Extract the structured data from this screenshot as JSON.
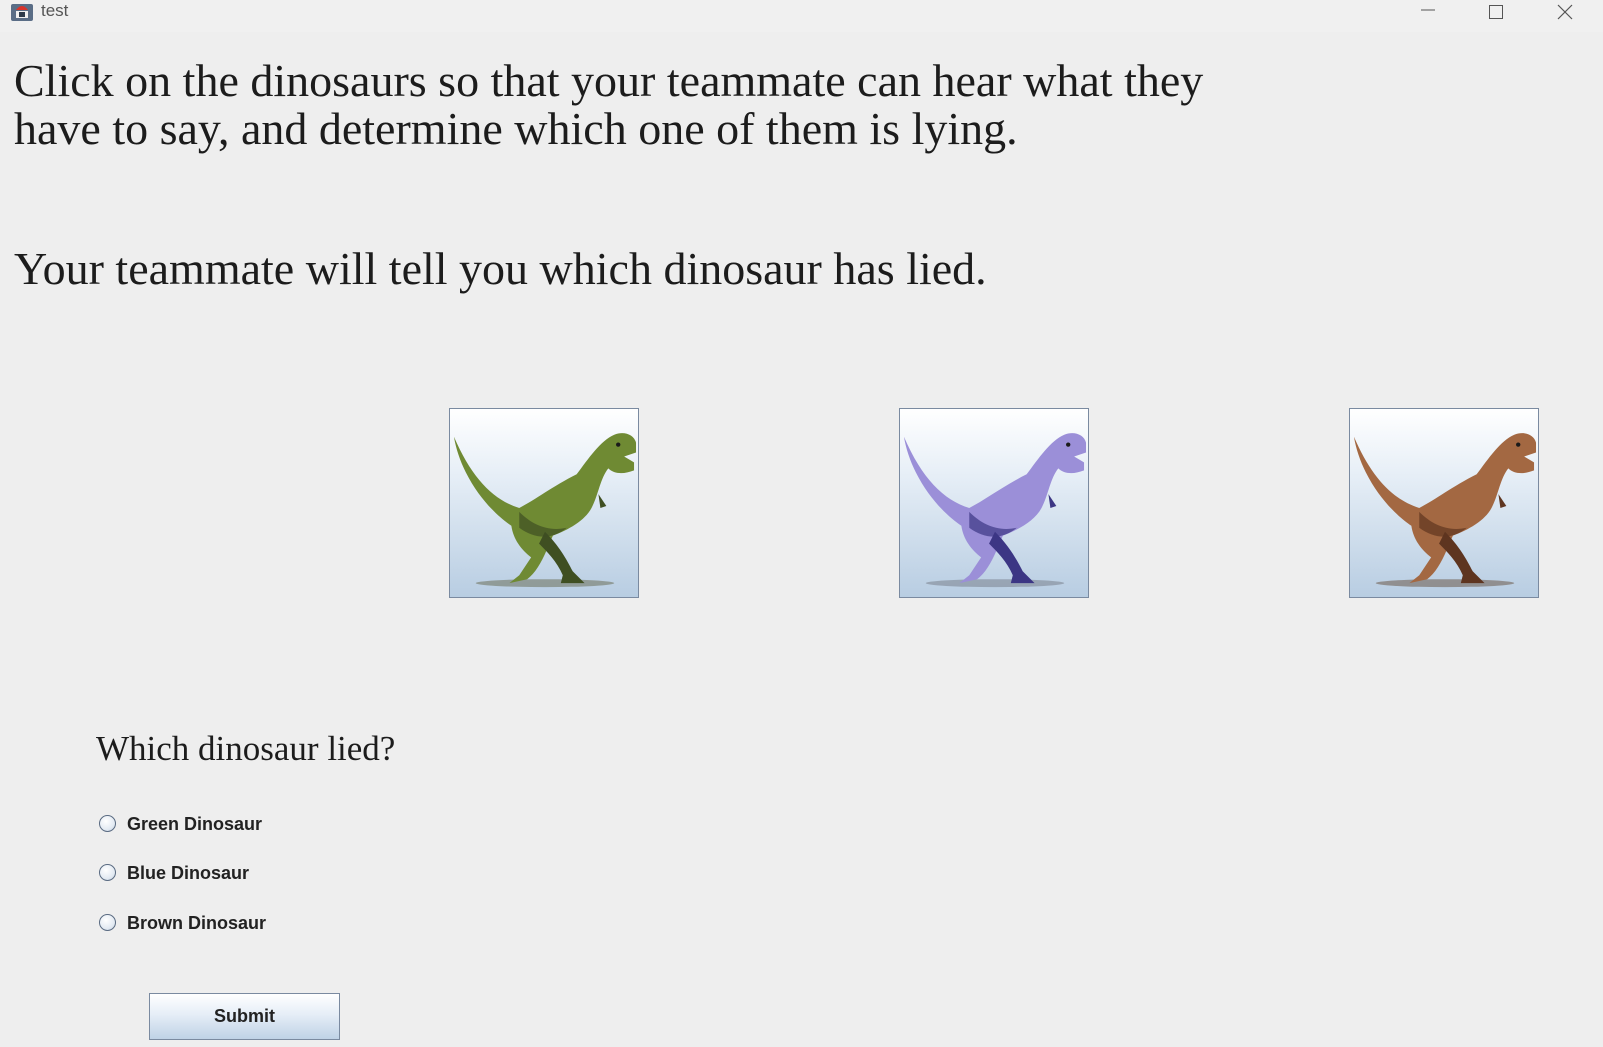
{
  "window": {
    "title": "test"
  },
  "instructions": {
    "line1": "Click on the dinosaurs so that your teammate can hear what they have to say, and determine which one of them is lying.",
    "line2": "Your teammate will tell you which dinosaur has lied."
  },
  "dinosaurs": [
    {
      "name": "green-dinosaur",
      "body_color": "#6f8a33",
      "shade_color": "#3f4f22",
      "icon": "green-dinosaur-icon"
    },
    {
      "name": "blue-dinosaur",
      "body_color": "#9b8fd8",
      "shade_color": "#3c3684",
      "icon": "blue-dinosaur-icon"
    },
    {
      "name": "brown-dinosaur",
      "body_color": "#a36842",
      "shade_color": "#5e3520",
      "icon": "brown-dinosaur-icon"
    }
  ],
  "question": {
    "label": "Which dinosaur lied?",
    "options": [
      "Green Dinosaur",
      "Blue Dinosaur",
      "Brown Dinosaur"
    ],
    "selected": null
  },
  "submit": {
    "label": "Submit"
  }
}
